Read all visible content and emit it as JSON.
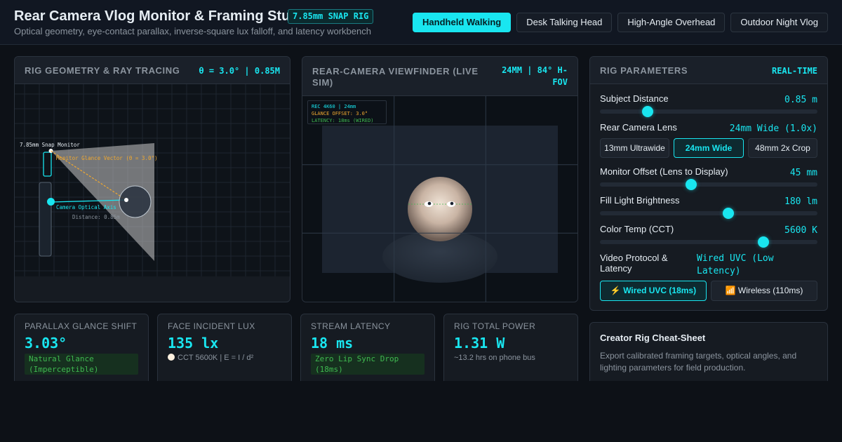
{
  "header": {
    "title": "Rear Camera Vlog Monitor & Framing Studio",
    "badge": "7.85mm SNAP RIG",
    "subtitle": "Optical geometry, eye-contact parallax, inverse-square lux falloff, and latency workbench",
    "presets": [
      {
        "label": "Handheld Walking",
        "active": true
      },
      {
        "label": "Desk Talking Head",
        "active": false
      },
      {
        "label": "High-Angle Overhead",
        "active": false
      },
      {
        "label": "Outdoor Night Vlog",
        "active": false
      }
    ]
  },
  "geometry": {
    "title": "Rig Geometry & Ray Tracing",
    "meta": "θ = 3.0° | 0.85M",
    "monitor_label": "7.85mm Snap Monitor",
    "glance_label": "Monitor Glance Vector (θ = 3.0°)",
    "axis_label": "Camera Optical Axis",
    "distance_label": "Distance: 0.85m"
  },
  "viewfinder": {
    "title": "Rear-Camera Viewfinder (Live Sim)",
    "meta": "24MM | 84° H-FOV",
    "hud_line1": "REC 4K60 | 24mm",
    "hud_line2": "GLANCE OFFSET: 3.0°",
    "hud_line3": "LATENCY: 18ms (WIRED)"
  },
  "params": {
    "title": "Rig Parameters",
    "meta": "REAL-TIME",
    "subject_distance": {
      "label": "Subject Distance",
      "value": "0.85 m",
      "level": 0.22
    },
    "lens": {
      "label": "Rear Camera Lens",
      "value": "24mm Wide (1.0x)",
      "options": [
        {
          "label": "13mm Ultrawide",
          "active": false
        },
        {
          "label": "24mm Wide",
          "active": true
        },
        {
          "label": "48mm 2x Crop",
          "active": false
        }
      ]
    },
    "monitor_offset": {
      "label": "Monitor Offset (Lens to Display)",
      "value": "45 mm",
      "level": 0.42
    },
    "fill_light": {
      "label": "Fill Light Brightness",
      "value": "180 lm",
      "level": 0.59
    },
    "color_temp": {
      "label": "Color Temp (CCT)",
      "value": "5600 K",
      "level": 0.75
    },
    "protocol": {
      "label": "Video Protocol & Latency",
      "value": "Wired UVC (Low Latency)",
      "options": [
        {
          "label": "Wired UVC (18ms)",
          "icon": "lightning-icon",
          "active": true
        },
        {
          "label": "Wireless (110ms)",
          "icon": "wifi-signal-icon",
          "active": false
        }
      ]
    }
  },
  "metrics": [
    {
      "label": "Parallax Glance Shift",
      "value": "3.03°",
      "note": "Natural Glance (Imperceptible)"
    },
    {
      "label": "Face Incident Lux",
      "value": "135 lx",
      "sub": "CCT 5600K | E = I / d²"
    },
    {
      "label": "Stream Latency",
      "value": "18 ms",
      "note": "Zero Lip Sync Drop (18ms)"
    },
    {
      "label": "Rig Total Power",
      "value": "1.31 W",
      "sub": "~13.2 hrs on phone bus"
    }
  ],
  "cheat_sheet": {
    "title": "Creator Rig Cheat-Sheet",
    "text": "Export calibrated framing targets, optical angles, and lighting parameters for field production."
  },
  "colors": {
    "accent": "#19e6f0",
    "good": "#3fb950",
    "warn": "#f0a830",
    "background": "#0d1117"
  }
}
